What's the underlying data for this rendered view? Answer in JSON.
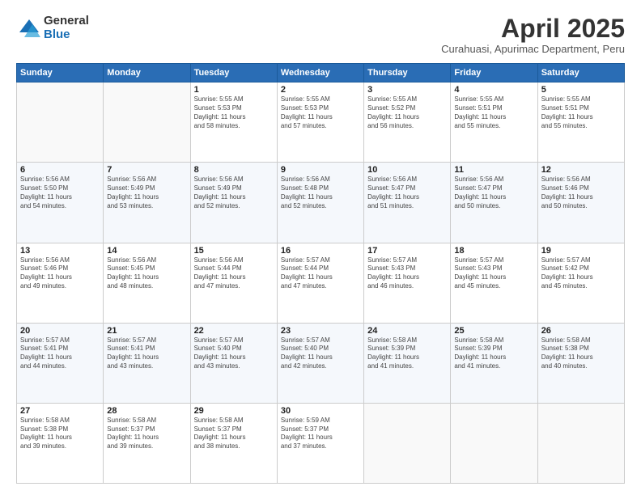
{
  "header": {
    "logo_general": "General",
    "logo_blue": "Blue",
    "month_title": "April 2025",
    "subtitle": "Curahuasi, Apurimac Department, Peru"
  },
  "weekdays": [
    "Sunday",
    "Monday",
    "Tuesday",
    "Wednesday",
    "Thursday",
    "Friday",
    "Saturday"
  ],
  "weeks": [
    [
      {
        "day": "",
        "info": ""
      },
      {
        "day": "",
        "info": ""
      },
      {
        "day": "1",
        "info": "Sunrise: 5:55 AM\nSunset: 5:53 PM\nDaylight: 11 hours\nand 58 minutes."
      },
      {
        "day": "2",
        "info": "Sunrise: 5:55 AM\nSunset: 5:53 PM\nDaylight: 11 hours\nand 57 minutes."
      },
      {
        "day": "3",
        "info": "Sunrise: 5:55 AM\nSunset: 5:52 PM\nDaylight: 11 hours\nand 56 minutes."
      },
      {
        "day": "4",
        "info": "Sunrise: 5:55 AM\nSunset: 5:51 PM\nDaylight: 11 hours\nand 55 minutes."
      },
      {
        "day": "5",
        "info": "Sunrise: 5:55 AM\nSunset: 5:51 PM\nDaylight: 11 hours\nand 55 minutes."
      }
    ],
    [
      {
        "day": "6",
        "info": "Sunrise: 5:56 AM\nSunset: 5:50 PM\nDaylight: 11 hours\nand 54 minutes."
      },
      {
        "day": "7",
        "info": "Sunrise: 5:56 AM\nSunset: 5:49 PM\nDaylight: 11 hours\nand 53 minutes."
      },
      {
        "day": "8",
        "info": "Sunrise: 5:56 AM\nSunset: 5:49 PM\nDaylight: 11 hours\nand 52 minutes."
      },
      {
        "day": "9",
        "info": "Sunrise: 5:56 AM\nSunset: 5:48 PM\nDaylight: 11 hours\nand 52 minutes."
      },
      {
        "day": "10",
        "info": "Sunrise: 5:56 AM\nSunset: 5:47 PM\nDaylight: 11 hours\nand 51 minutes."
      },
      {
        "day": "11",
        "info": "Sunrise: 5:56 AM\nSunset: 5:47 PM\nDaylight: 11 hours\nand 50 minutes."
      },
      {
        "day": "12",
        "info": "Sunrise: 5:56 AM\nSunset: 5:46 PM\nDaylight: 11 hours\nand 50 minutes."
      }
    ],
    [
      {
        "day": "13",
        "info": "Sunrise: 5:56 AM\nSunset: 5:46 PM\nDaylight: 11 hours\nand 49 minutes."
      },
      {
        "day": "14",
        "info": "Sunrise: 5:56 AM\nSunset: 5:45 PM\nDaylight: 11 hours\nand 48 minutes."
      },
      {
        "day": "15",
        "info": "Sunrise: 5:56 AM\nSunset: 5:44 PM\nDaylight: 11 hours\nand 47 minutes."
      },
      {
        "day": "16",
        "info": "Sunrise: 5:57 AM\nSunset: 5:44 PM\nDaylight: 11 hours\nand 47 minutes."
      },
      {
        "day": "17",
        "info": "Sunrise: 5:57 AM\nSunset: 5:43 PM\nDaylight: 11 hours\nand 46 minutes."
      },
      {
        "day": "18",
        "info": "Sunrise: 5:57 AM\nSunset: 5:43 PM\nDaylight: 11 hours\nand 45 minutes."
      },
      {
        "day": "19",
        "info": "Sunrise: 5:57 AM\nSunset: 5:42 PM\nDaylight: 11 hours\nand 45 minutes."
      }
    ],
    [
      {
        "day": "20",
        "info": "Sunrise: 5:57 AM\nSunset: 5:41 PM\nDaylight: 11 hours\nand 44 minutes."
      },
      {
        "day": "21",
        "info": "Sunrise: 5:57 AM\nSunset: 5:41 PM\nDaylight: 11 hours\nand 43 minutes."
      },
      {
        "day": "22",
        "info": "Sunrise: 5:57 AM\nSunset: 5:40 PM\nDaylight: 11 hours\nand 43 minutes."
      },
      {
        "day": "23",
        "info": "Sunrise: 5:57 AM\nSunset: 5:40 PM\nDaylight: 11 hours\nand 42 minutes."
      },
      {
        "day": "24",
        "info": "Sunrise: 5:58 AM\nSunset: 5:39 PM\nDaylight: 11 hours\nand 41 minutes."
      },
      {
        "day": "25",
        "info": "Sunrise: 5:58 AM\nSunset: 5:39 PM\nDaylight: 11 hours\nand 41 minutes."
      },
      {
        "day": "26",
        "info": "Sunrise: 5:58 AM\nSunset: 5:38 PM\nDaylight: 11 hours\nand 40 minutes."
      }
    ],
    [
      {
        "day": "27",
        "info": "Sunrise: 5:58 AM\nSunset: 5:38 PM\nDaylight: 11 hours\nand 39 minutes."
      },
      {
        "day": "28",
        "info": "Sunrise: 5:58 AM\nSunset: 5:37 PM\nDaylight: 11 hours\nand 39 minutes."
      },
      {
        "day": "29",
        "info": "Sunrise: 5:58 AM\nSunset: 5:37 PM\nDaylight: 11 hours\nand 38 minutes."
      },
      {
        "day": "30",
        "info": "Sunrise: 5:59 AM\nSunset: 5:37 PM\nDaylight: 11 hours\nand 37 minutes."
      },
      {
        "day": "",
        "info": ""
      },
      {
        "day": "",
        "info": ""
      },
      {
        "day": "",
        "info": ""
      }
    ]
  ]
}
